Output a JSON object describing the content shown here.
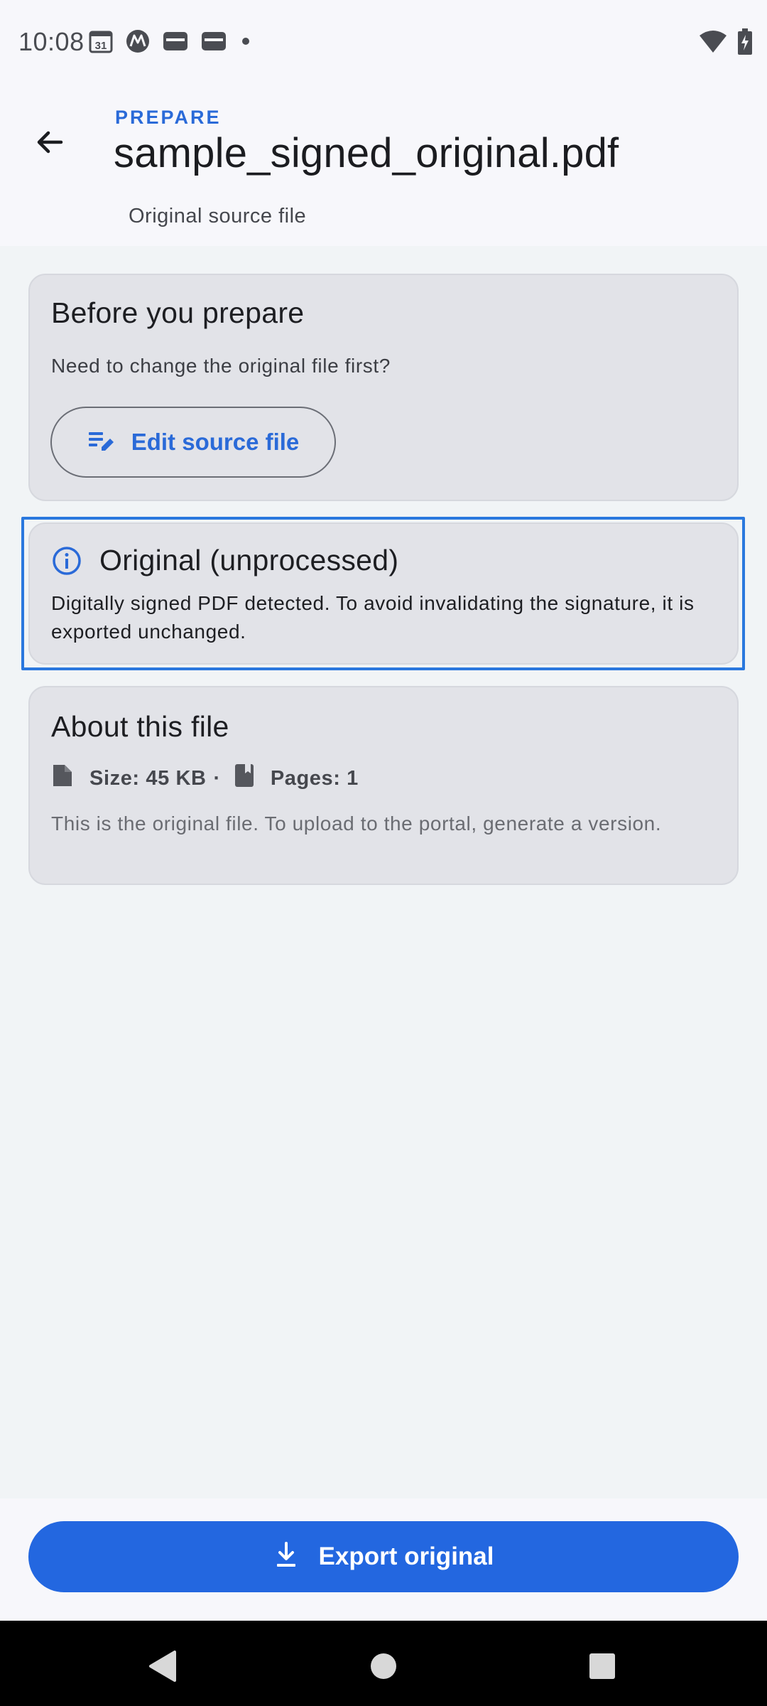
{
  "status_bar": {
    "time": "10:08",
    "calendar_day": "31",
    "left_icons": [
      "calendar-icon",
      "motorola-icon",
      "wallet-icon",
      "wallet-icon",
      "dot-icon"
    ],
    "right_icons": [
      "wifi-icon",
      "battery-charging-icon"
    ]
  },
  "app_bar": {
    "overline": "PREPARE",
    "title": "sample_signed_original.pdf",
    "subtitle": "Original source file",
    "back_icon": "arrow-back-icon"
  },
  "prepare_card": {
    "title": "Before you prepare",
    "body": "Need to change the original file first?",
    "edit_button": {
      "label": "Edit source file",
      "icon": "edit-note-icon"
    }
  },
  "status_card": {
    "icon": "info-icon",
    "title": "Original (unprocessed)",
    "body": "Digitally signed PDF detected. To avoid invalidating the signature, it is exported unchanged."
  },
  "about_card": {
    "title": "About this file",
    "size": "Size: 45 KB",
    "separator": "·",
    "pages": "Pages: 1",
    "body": "This is the original file. To upload to the portal, generate a version."
  },
  "footer": {
    "export_button": {
      "label": "Export original",
      "icon": "download-icon"
    }
  },
  "nav_bar": {
    "buttons": [
      "nav-back-icon",
      "nav-home-icon",
      "nav-recents-icon"
    ]
  },
  "colors": {
    "accent": "#2a6ad8",
    "primary_button": "#2367e0",
    "card_background": "#e2e3e8",
    "highlight_border": "#2a78de",
    "page_background": "#f1f4f6"
  }
}
